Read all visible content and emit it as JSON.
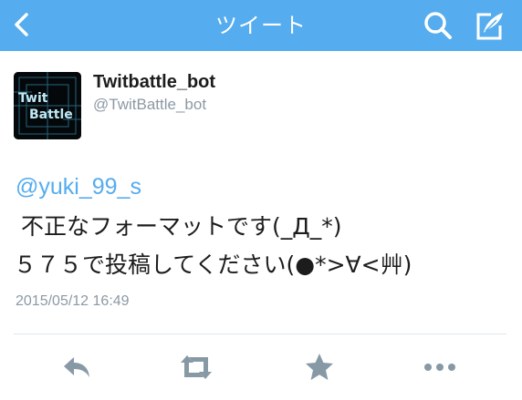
{
  "nav": {
    "title": "ツイート",
    "back_icon": "chevron-left-icon",
    "search_icon": "search-icon",
    "compose_icon": "compose-icon",
    "bar_color": "#55acee"
  },
  "tweet": {
    "author": {
      "display_name": "Twitbattle_bot",
      "handle": "@TwitBattle_bot",
      "avatar_logo_text": [
        "Twit",
        "Battle"
      ]
    },
    "mention": "@yuki_99_s",
    "lines": [
      " 不正なフォーマットです(_Д_*)",
      "５７５で投稿してください(●*>∀<艸)"
    ],
    "timestamp": "2015/05/12 16:49"
  },
  "actions": {
    "reply": "reply-icon",
    "retweet": "retweet-icon",
    "favorite": "star-icon",
    "more": "more-icon"
  },
  "colors": {
    "accent": "#55acee",
    "text": "#1c1c1c",
    "muted": "#8c99a4",
    "action_icon": "#8899a6"
  }
}
